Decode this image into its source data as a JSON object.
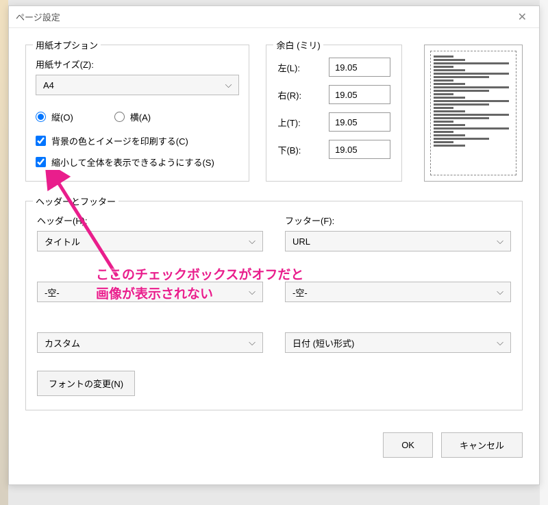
{
  "dialog": {
    "title": "ページ設定"
  },
  "paper": {
    "group_label": "用紙オプション",
    "size_label": "用紙サイズ(Z):",
    "size_value": "A4",
    "orientation_portrait": "縦(O)",
    "orientation_landscape": "横(A)",
    "print_bg_label": "背景の色とイメージを印刷する(C)",
    "shrink_label": "縮小して全体を表示できるようにする(S)"
  },
  "margins": {
    "group_label": "余白 (ミリ)",
    "left_label": "左(L):",
    "left_value": "19.05",
    "right_label": "右(R):",
    "right_value": "19.05",
    "top_label": "上(T):",
    "top_value": "19.05",
    "bottom_label": "下(B):",
    "bottom_value": "19.05"
  },
  "headerfooter": {
    "group_label": "ヘッダーとフッター",
    "header_label": "ヘッダー(H):",
    "footer_label": "フッター(F):",
    "header1": "タイトル",
    "footer1": "URL",
    "header2": "-空-",
    "footer2": "-空-",
    "header3": "カスタム",
    "footer3": "日付 (短い形式)",
    "font_button": "フォントの変更(N)"
  },
  "buttons": {
    "ok": "OK",
    "cancel": "キャンセル"
  },
  "annotation": {
    "line1": "ここのチェックボックスがオフだと",
    "line2": "画像が表示されない"
  }
}
